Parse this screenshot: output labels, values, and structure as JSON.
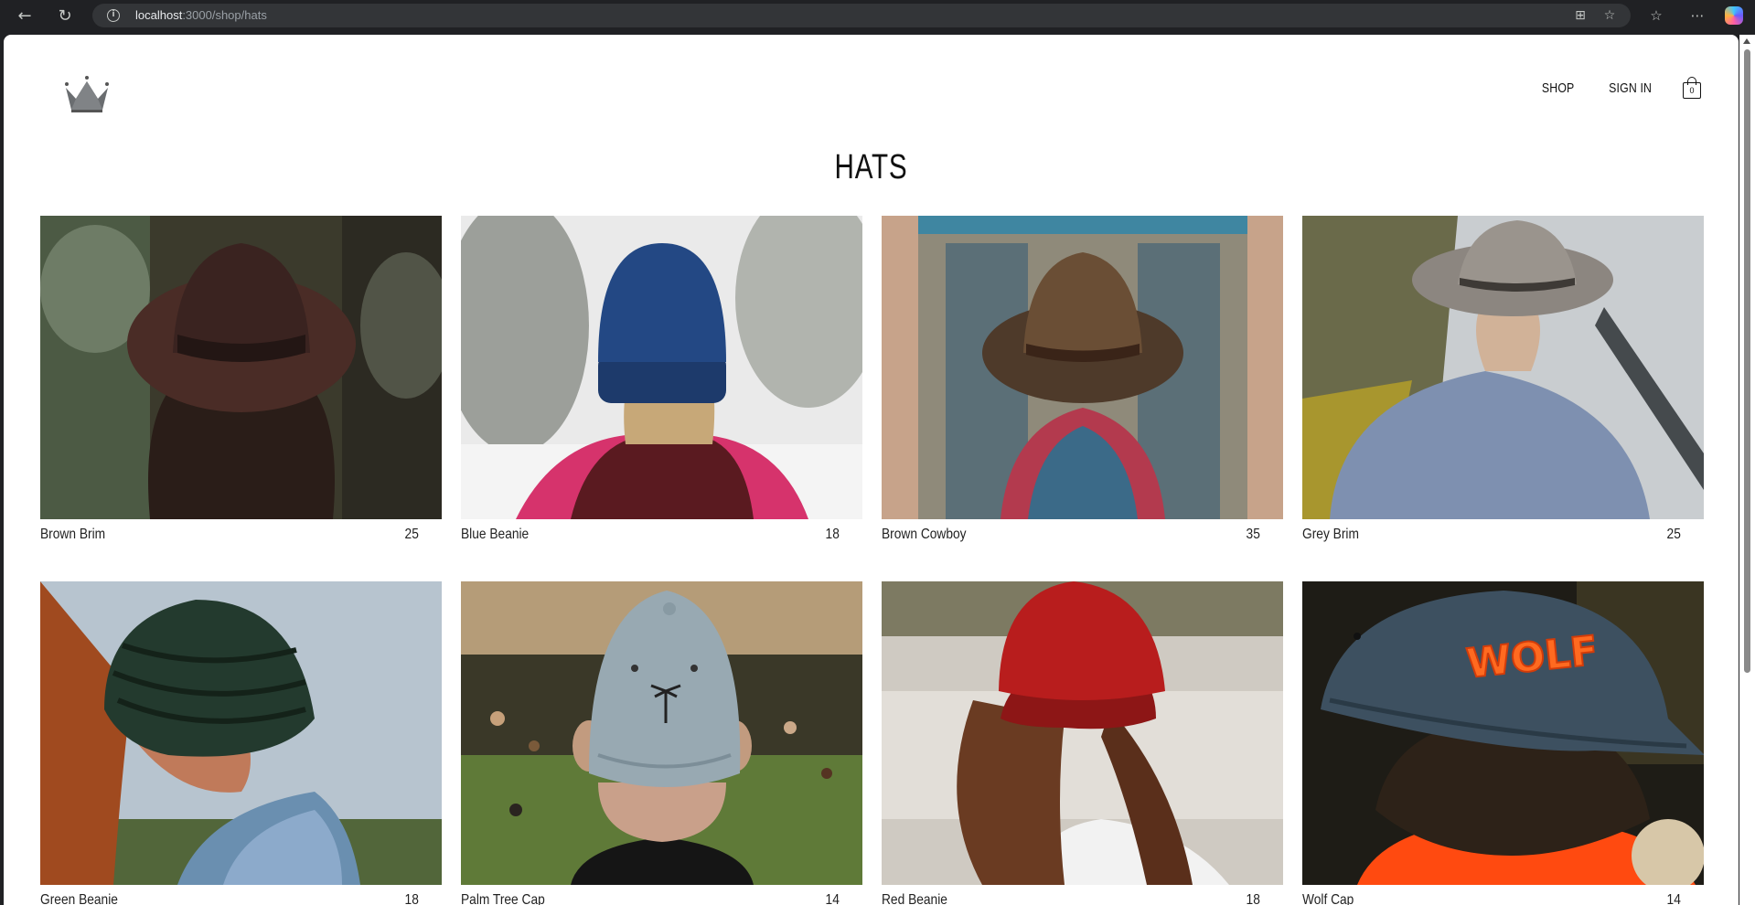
{
  "browser": {
    "url_host": "localhost",
    "url_rest": ":3000/shop/hats"
  },
  "header": {
    "logo_icon": "crown-icon",
    "nav": {
      "shop": "SHOP",
      "sign_in": "SIGN IN"
    },
    "cart_count": "0"
  },
  "page": {
    "title": "HATS"
  },
  "products": [
    {
      "name": "Brown Brim",
      "price": "25"
    },
    {
      "name": "Blue Beanie",
      "price": "18"
    },
    {
      "name": "Brown Cowboy",
      "price": "35"
    },
    {
      "name": "Grey Brim",
      "price": "25"
    },
    {
      "name": "Green Beanie",
      "price": "18"
    },
    {
      "name": "Palm Tree Cap",
      "price": "14"
    },
    {
      "name": "Red Beanie",
      "price": "18"
    },
    {
      "name": "Wolf Cap",
      "price": "14"
    }
  ],
  "wolf_cap_text": "WOLF"
}
